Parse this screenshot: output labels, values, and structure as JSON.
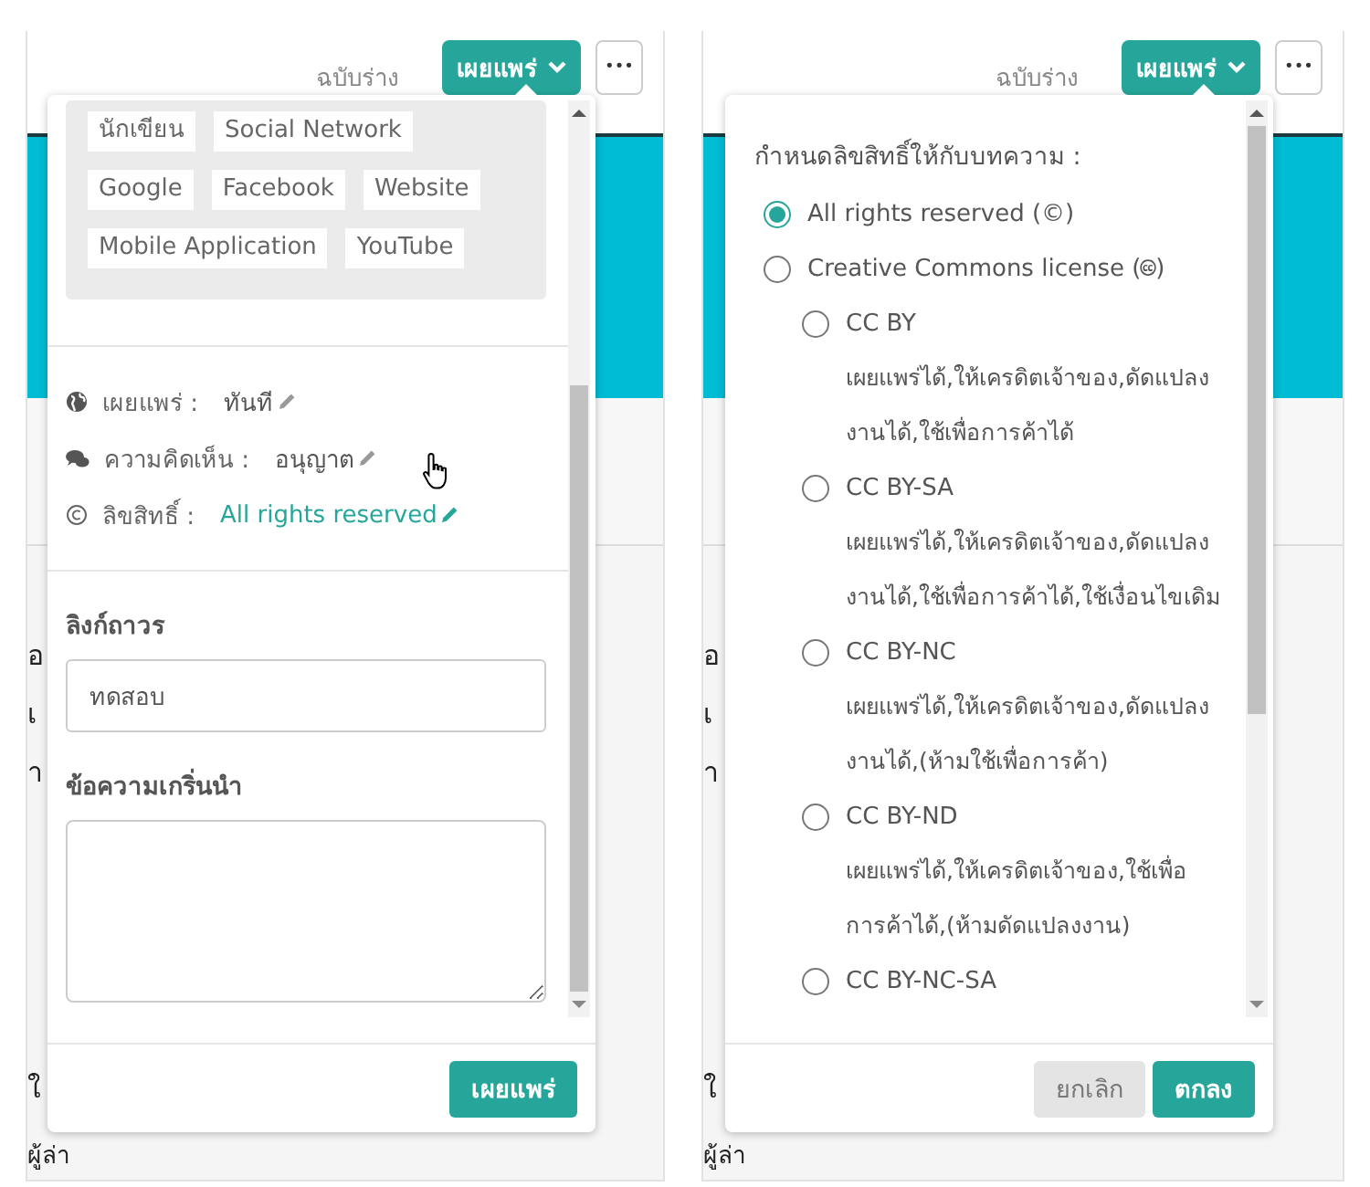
{
  "panels": [
    {
      "kind": "settings",
      "header": {
        "draft": "ฉบับร่าง",
        "publish": "เผยแพร่",
        "more": "•••"
      },
      "page_text": [
        "อ",
        "เ",
        "า",
        "ใ",
        "ผู้ล่า"
      ],
      "popover": {
        "tags": [
          "นักเขียน",
          "Social Network",
          "Google",
          "Facebook",
          "Website",
          "Mobile Application",
          "YouTube"
        ],
        "settings": [
          {
            "kind": "globe",
            "label": "เผยแพร่ :",
            "value": "ทันที",
            "link": false
          },
          {
            "kind": "comments",
            "label": "ความคิดเห็น :",
            "value": "อนุญาต",
            "link": false
          },
          {
            "kind": "copyright",
            "label": "ลิขสิทธิ์ :",
            "value": "All rights reserved",
            "link": true
          }
        ],
        "fields": [
          {
            "label": "ลิงก์ถาวร",
            "value": "ทดสอบ",
            "multiline": false
          },
          {
            "label": "ข้อความเกริ่นนำ",
            "multiline": true
          }
        ],
        "buttons": [
          {
            "label": "เผยแพร่",
            "kind": "primary"
          }
        ]
      }
    },
    {
      "kind": "license",
      "header": {
        "draft": "ฉบับร่าง",
        "publish": "เผยแพร่",
        "more": "•••"
      },
      "page_text": [
        "อ",
        "เ",
        "า",
        "ใ",
        "ผู้ล่า"
      ],
      "popover": {
        "title": "กำหนดลิขสิทธิ์ให้กับบทความ :",
        "options": [
          {
            "label": "All rights reserved (©)",
            "selected": true
          },
          {
            "label": "Creative Commons license (🅭)",
            "selected": false,
            "children": [
              {
                "label": "CC BY",
                "selected": false,
                "description": "เผยแพร่ได้,ให้เครดิตเจ้าของ,ดัดแปลงงานได้,ใช้เพื่อการค้าได้"
              },
              {
                "label": "CC BY-SA",
                "selected": false,
                "description": "เผยแพร่ได้,ให้เครดิตเจ้าของ,ดัดแปลงงานได้,ใช้เพื่อการค้าได้,ใช้เงื่อนไขเดิม"
              },
              {
                "label": "CC BY-NC",
                "selected": false,
                "description": "เผยแพร่ได้,ให้เครดิตเจ้าของ,ดัดแปลงงานได้,(ห้ามใช้เพื่อการค้า)"
              },
              {
                "label": "CC BY-ND",
                "selected": false,
                "description": "เผยแพร่ได้,ให้เครดิตเจ้าของ,ใช้เพื่อการค้าได้,(ห้ามดัดแปลงงาน)"
              },
              {
                "label": "CC BY-NC-SA",
                "selected": false
              }
            ]
          }
        ],
        "buttons": [
          {
            "label": "ยกเลิก",
            "kind": "secondary"
          },
          {
            "label": "ตกลง",
            "kind": "primary"
          }
        ]
      }
    }
  ]
}
